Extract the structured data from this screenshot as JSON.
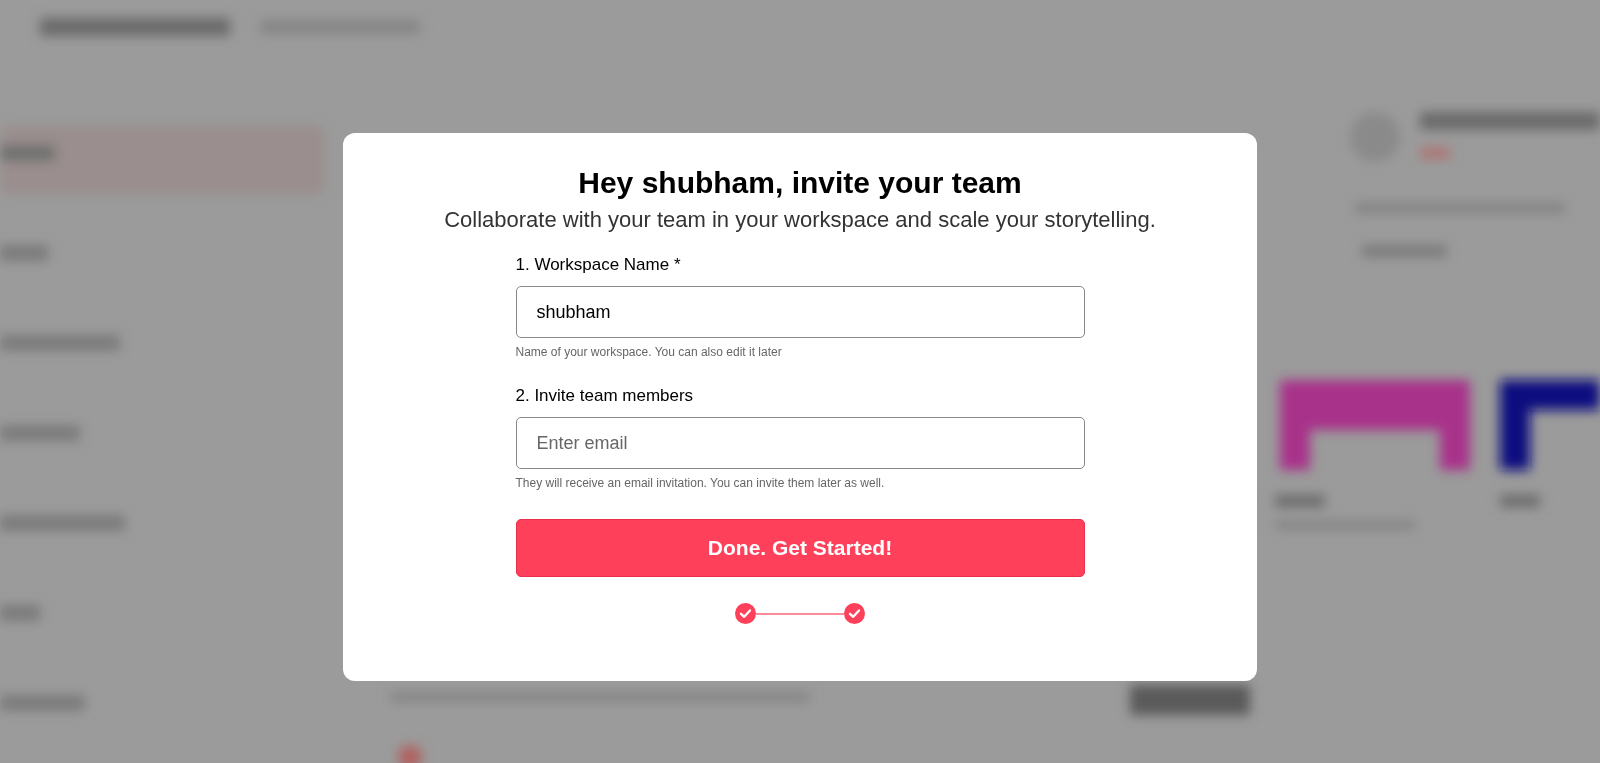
{
  "dialog": {
    "title": "Hey shubham, invite your team",
    "subtitle": "Collaborate with your team in your workspace and scale your storytelling.",
    "fields": [
      {
        "label": "1. Workspace Name *",
        "value": "shubham",
        "help": "Name of your workspace. You can also edit it later"
      },
      {
        "label": "2. Invite team members",
        "placeholder": "Enter email",
        "help": "They will receive an email invitation. You can invite them later as well."
      }
    ],
    "button": "Done. Get Started!",
    "steps": [
      {
        "done": true
      },
      {
        "done": true
      }
    ]
  }
}
